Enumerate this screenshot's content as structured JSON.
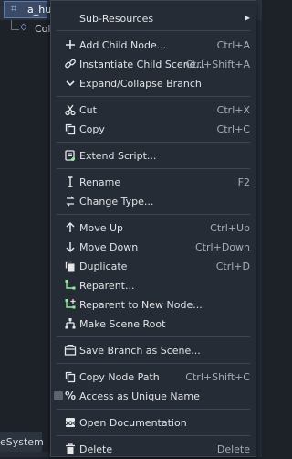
{
  "scene_tree": {
    "selected_node": "a_hurtbox",
    "child_node": "Coll",
    "bottom_tab": "eSystem"
  },
  "menu": {
    "submenu_header": "Sub-Resources",
    "items": {
      "add_child": {
        "label": "Add Child Node...",
        "shortcut": "Ctrl+A"
      },
      "instantiate": {
        "label": "Instantiate Child Scene...",
        "shortcut": "Ctrl+Shift+A"
      },
      "expand": {
        "label": "Expand/Collapse Branch",
        "shortcut": ""
      },
      "cut": {
        "label": "Cut",
        "shortcut": "Ctrl+X"
      },
      "copy": {
        "label": "Copy",
        "shortcut": "Ctrl+C"
      },
      "extend": {
        "label": "Extend Script...",
        "shortcut": ""
      },
      "rename": {
        "label": "Rename",
        "shortcut": "F2"
      },
      "change_type": {
        "label": "Change Type...",
        "shortcut": ""
      },
      "move_up": {
        "label": "Move Up",
        "shortcut": "Ctrl+Up"
      },
      "move_down": {
        "label": "Move Down",
        "shortcut": "Ctrl+Down"
      },
      "duplicate": {
        "label": "Duplicate",
        "shortcut": "Ctrl+D"
      },
      "reparent": {
        "label": "Reparent...",
        "shortcut": ""
      },
      "reparent_new": {
        "label": "Reparent to New Node...",
        "shortcut": ""
      },
      "make_root": {
        "label": "Make Scene Root",
        "shortcut": ""
      },
      "save_branch": {
        "label": "Save Branch as Scene...",
        "shortcut": ""
      },
      "copy_path": {
        "label": "Copy Node Path",
        "shortcut": "Ctrl+Shift+C"
      },
      "unique_name": {
        "label": "Access as Unique Name",
        "shortcut": ""
      },
      "open_docs": {
        "label": "Open Documentation",
        "shortcut": ""
      },
      "delete": {
        "label": "Delete",
        "shortcut": "Delete"
      }
    }
  },
  "colors": {
    "accent_green": "#8eef97",
    "accent_blue": "#8eb8ff",
    "menu_bg": "#262c36"
  }
}
